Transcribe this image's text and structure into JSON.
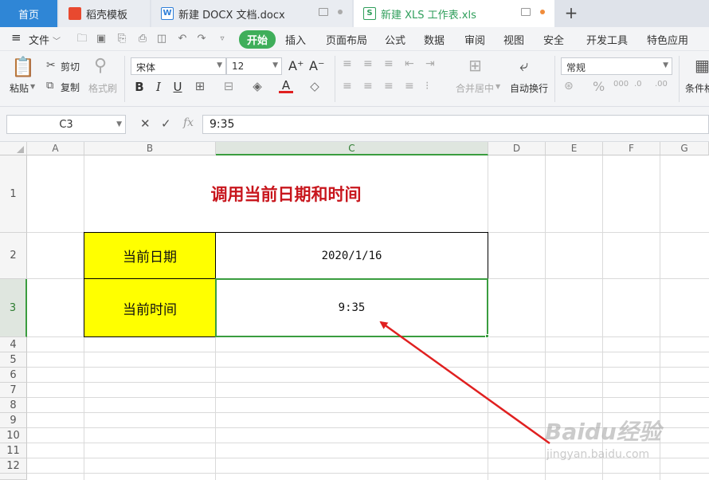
{
  "tabs": [
    {
      "label": "首页"
    },
    {
      "label": "稻壳模板"
    },
    {
      "label": "新建 DOCX 文档.docx"
    },
    {
      "label": "新建 XLS 工作表.xls"
    }
  ],
  "menu": {
    "file": "文件",
    "items": [
      "开始",
      "插入",
      "页面布局",
      "公式",
      "数据",
      "审阅",
      "视图",
      "安全",
      "开发工具",
      "特色应用"
    ]
  },
  "ribbon": {
    "paste": "粘贴",
    "cut": "剪切",
    "copy": "复制",
    "format_painter": "格式刷",
    "font_name": "宋体",
    "font_size": "12",
    "merge_center": "合并居中",
    "wrap_text": "自动换行",
    "number_format": "常规",
    "conditional_format": "条件格"
  },
  "formula_bar": {
    "name_box": "C3",
    "fx": "fx",
    "formula": "9:35"
  },
  "sheet": {
    "columns": [
      "A",
      "B",
      "C",
      "D",
      "E",
      "F",
      "G"
    ],
    "rows": [
      "1",
      "2",
      "3",
      "4",
      "5",
      "6",
      "7",
      "8",
      "9",
      "10",
      "11",
      "12"
    ],
    "title": "调用当前日期和时间",
    "date_label": "当前日期",
    "date_value": "2020/1/16",
    "time_label": "当前时间",
    "time_value": "9:35",
    "active_cell": "C3"
  },
  "colors": {
    "accent_green": "#3a9d3f",
    "title_red": "#c8161d",
    "label_yellow": "#ffff00",
    "arrow_red": "#e02020",
    "home_tab_blue": "#2f86d6"
  },
  "watermark": {
    "brand": "Baidu经验",
    "url": "jingyan.baidu.com"
  }
}
